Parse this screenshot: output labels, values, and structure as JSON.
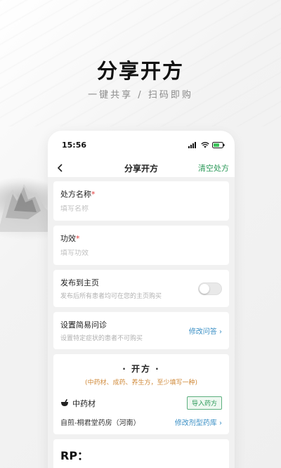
{
  "hero": {
    "title": "分享开方",
    "subtitle": "一键共享 / 扫码即购"
  },
  "status_bar": {
    "time": "15:56"
  },
  "nav": {
    "back_icon": "chevron-left-icon",
    "title": "分享开方",
    "action": "清空处方"
  },
  "form": {
    "rx_name": {
      "label": "处方名称",
      "required_mark": "*",
      "placeholder": "填写名称"
    },
    "efficacy": {
      "label": "功效",
      "required_mark": "*",
      "placeholder": "填写功效"
    },
    "publish": {
      "label": "发布到主页",
      "hint": "发布后所有患者均可在您的主页购买",
      "enabled": false
    },
    "consult": {
      "label": "设置简易问诊",
      "hint": "设置特定症状的患者不可购买",
      "action": "修改问答 ›"
    }
  },
  "prescription": {
    "title": "· 开方 ·",
    "hint": "(中药材、成药、养生方，至少填写一种)",
    "herb": {
      "label": "中药材",
      "import_button": "导入药方"
    },
    "pharmacy": {
      "name": "自煎-桐君堂药房（河南）",
      "action": "修改剂型药库 ›"
    },
    "rp_label": "RP："
  },
  "colors": {
    "accent_green": "#2d9a5a",
    "link_blue": "#3a8fc5",
    "required_red": "#e03b3b",
    "hint_orange": "#d08a3a"
  }
}
